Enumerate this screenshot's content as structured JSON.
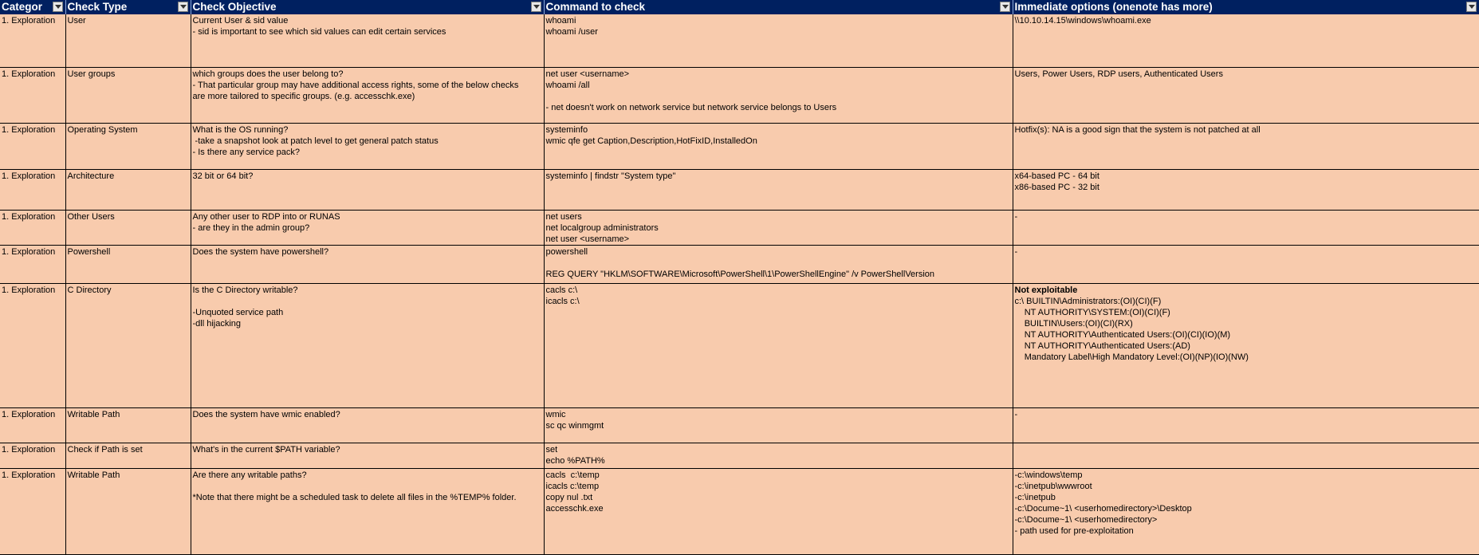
{
  "columns": [
    "Categor",
    "Check Type",
    "Check Objective",
    "Command to check",
    "Immediate options (onenote has more)"
  ],
  "rows": [
    {
      "category": "1. Exploration",
      "check_type": "User",
      "objective": "Current User & sid value\n- sid is important to see which sid values can edit certain services",
      "command": "whoami\nwhoami /user",
      "options_head": "",
      "options": "\\\\10.10.14.15\\windows\\whoami.exe"
    },
    {
      "category": "1. Exploration",
      "check_type": "User groups",
      "objective": "which groups does the user belong to?\n- That particular group may have additional access rights, some of the below checks\nare more tailored to specific groups. (e.g. accesschk.exe)",
      "command": "net user <username>\nwhoami /all\n\n- net doesn't work on network service but network service belongs to Users",
      "options_head": "",
      "options": "Users, Power Users, RDP users, Authenticated Users"
    },
    {
      "category": "1. Exploration",
      "check_type": "Operating System",
      "objective": "What is the OS running?\n -take a snapshot look at patch level to get general patch status\n- Is there any service pack?",
      "command": "systeminfo\nwmic qfe get Caption,Description,HotFixID,InstalledOn",
      "options_head": "",
      "options": "Hotfix(s): NA is a good sign that the system is not patched at all"
    },
    {
      "category": "1. Exploration",
      "check_type": "Architecture",
      "objective": "32 bit or 64 bit?",
      "command": "systeminfo | findstr \"System type\"",
      "options_head": "",
      "options": "x64-based PC - 64 bit\nx86-based PC - 32 bit"
    },
    {
      "category": "1. Exploration",
      "check_type": "Other Users",
      "objective": "Any other user to RDP into or RUNAS\n- are they in the admin group?",
      "command": "net users\nnet localgroup administrators\nnet user <username>",
      "options_head": "",
      "options": "-"
    },
    {
      "category": "1. Exploration",
      "check_type": "Powershell",
      "objective": "Does the system have powershell?",
      "command": "powershell\n\nREG QUERY \"HKLM\\SOFTWARE\\Microsoft\\PowerShell\\1\\PowerShellEngine\" /v PowerShellVersion",
      "options_head": "",
      "options": "-"
    },
    {
      "category": "1. Exploration",
      "check_type": "C Directory",
      "objective": "Is the C Directory writable?\n\n-Unquoted service path\n-dll hijacking",
      "command": "cacls c:\\\nicacls c:\\",
      "options_head": "Not exploitable",
      "options": "c:\\ BUILTIN\\Administrators:(OI)(CI)(F)\n    NT AUTHORITY\\SYSTEM:(OI)(CI)(F)\n    BUILTIN\\Users:(OI)(CI)(RX)\n    NT AUTHORITY\\Authenticated Users:(OI)(CI)(IO)(M)\n    NT AUTHORITY\\Authenticated Users:(AD)\n    Mandatory Label\\High Mandatory Level:(OI)(NP)(IO)(NW)"
    },
    {
      "category": "1. Exploration",
      "check_type": "Writable Path",
      "objective": "Does the system have wmic enabled?",
      "command": "wmic\nsc qc winmgmt",
      "options_head": "",
      "options": "-"
    },
    {
      "category": "1. Exploration",
      "check_type": "Check if Path is set",
      "objective": "What's in the current $PATH variable?",
      "command": "set\necho %PATH%",
      "options_head": "",
      "options": ""
    },
    {
      "category": "1. Exploration",
      "check_type": "Writable Path",
      "objective": "Are there any writable paths?\n\n*Note that there might be a scheduled task to delete all files in the %TEMP% folder.",
      "command": "cacls  c:\\temp\nicacls c:\\temp\ncopy nul .txt\naccesschk.exe",
      "options_head": "",
      "options": "-c:\\windows\\temp\n-c:\\inetpub\\wwwroot\n-c:\\inetpub\n-c:\\Docume~1\\ <userhomedirectory>\\Desktop\n-c:\\Docume~1\\ <userhomedirectory>\n- path used for pre-exploitation"
    }
  ]
}
